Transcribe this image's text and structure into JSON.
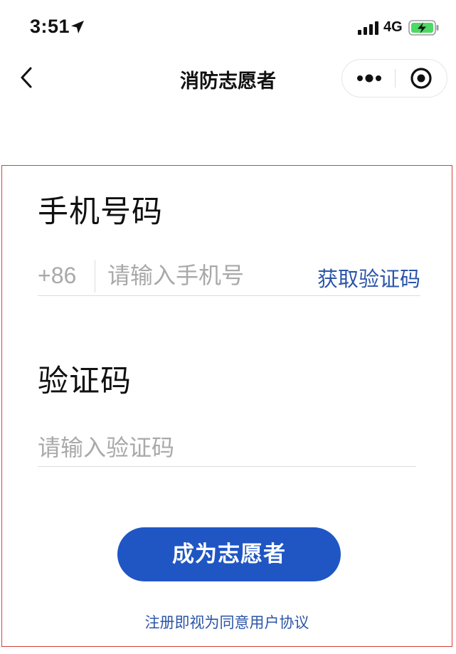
{
  "status_bar": {
    "time": "3:51",
    "network": "4G",
    "icons": [
      "location-arrow-icon",
      "signal-icon",
      "battery-charging-icon"
    ],
    "battery_color": "#4cd964"
  },
  "nav": {
    "title": "消防志愿者",
    "icons": [
      "back-chevron-icon",
      "more-dots-icon",
      "close-target-icon"
    ]
  },
  "form": {
    "phone_section_title": "手机号码",
    "country_code": "+86",
    "phone_placeholder": "请输入手机号",
    "phone_value": "",
    "get_code_label": "获取验证码",
    "code_section_title": "验证码",
    "code_placeholder": "请输入验证码",
    "code_value": "",
    "submit_label": "成为志愿者",
    "agreement_label": "注册即视为同意用户协议"
  },
  "colors": {
    "accent": "#1f56c4",
    "link": "#2c55a8",
    "highlight_border": "#d8413a",
    "placeholder": "#a9a9a9"
  }
}
